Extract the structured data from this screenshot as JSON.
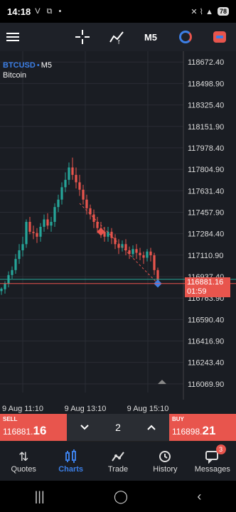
{
  "status": {
    "time": "14:18",
    "left_icons": "V ⧉ •",
    "right_icons": "✕ ⌇ ▲",
    "battery": "78"
  },
  "toolbar": {
    "menu_icon": "hamburger-icon",
    "crosshair_icon": "crosshair-icon",
    "indicator_icon": "indicator-icon",
    "timeframe": "M5",
    "objects_icon": "circle-icon",
    "trade_icon": "trade-icon"
  },
  "symbol": {
    "name": "BTCUSD",
    "timeframe": "M5",
    "description": "Bitcoin"
  },
  "price_tag": {
    "price": "116881.16",
    "countdown": "01:59"
  },
  "chart_data": {
    "type": "candlestick",
    "y_ticks": [
      "118672.40",
      "118498.90",
      "118325.40",
      "118151.90",
      "117978.40",
      "117804.90",
      "117631.40",
      "117457.90",
      "117284.40",
      "117110.90",
      "116937.40",
      "116763.90",
      "116590.40",
      "116416.90",
      "116243.40",
      "116069.90"
    ],
    "x_ticks": [
      "9 Aug 11:10",
      "9 Aug 13:10",
      "9 Aug 15:10"
    ],
    "ylim": [
      116000,
      118760
    ],
    "current_price": 116881.16,
    "ask_price": 116898.21,
    "colors": {
      "up": "#26a69a",
      "down": "#e8554d",
      "background": "#1a1d23",
      "grid": "#2a2d35"
    },
    "candles": [
      [
        116820,
        116840,
        116790,
        116850
      ],
      [
        116835,
        116880,
        116800,
        116900
      ],
      [
        116880,
        116950,
        116850,
        116980
      ],
      [
        116950,
        116990,
        116920,
        117020
      ],
      [
        116990,
        117080,
        116960,
        117120
      ],
      [
        117080,
        117150,
        117040,
        117200
      ],
      [
        117150,
        117200,
        117100,
        117260
      ],
      [
        117200,
        117380,
        117170,
        117400
      ],
      [
        117380,
        117300,
        117280,
        117420
      ],
      [
        117300,
        117290,
        117240,
        117350
      ],
      [
        117290,
        117260,
        117210,
        117330
      ],
      [
        117260,
        117340,
        117220,
        117370
      ],
      [
        117340,
        117400,
        117300,
        117440
      ],
      [
        117400,
        117350,
        117320,
        117450
      ],
      [
        117350,
        117380,
        117300,
        117420
      ],
      [
        117380,
        117500,
        117340,
        117530
      ],
      [
        117500,
        117560,
        117460,
        117600
      ],
      [
        117560,
        117660,
        117520,
        117700
      ],
      [
        117660,
        117720,
        117620,
        117780
      ],
      [
        117720,
        117820,
        117680,
        117860
      ],
      [
        117820,
        117760,
        117720,
        117900
      ],
      [
        117760,
        117700,
        117650,
        117820
      ],
      [
        117700,
        117640,
        117590,
        117760
      ],
      [
        117640,
        117560,
        117520,
        117680
      ],
      [
        117560,
        117490,
        117440,
        117600
      ],
      [
        117490,
        117440,
        117400,
        117520
      ],
      [
        117440,
        117380,
        117330,
        117480
      ],
      [
        117380,
        117330,
        117290,
        117420
      ],
      [
        117330,
        117300,
        117250,
        117380
      ],
      [
        117300,
        117260,
        117220,
        117340
      ],
      [
        117260,
        117300,
        117220,
        117340
      ],
      [
        117300,
        117250,
        117200,
        117330
      ],
      [
        117250,
        117200,
        117160,
        117280
      ],
      [
        117200,
        117170,
        117120,
        117240
      ],
      [
        117170,
        117200,
        117140,
        117230
      ],
      [
        117200,
        117150,
        117110,
        117240
      ],
      [
        117150,
        117120,
        117080,
        117180
      ],
      [
        117120,
        117160,
        117090,
        117190
      ],
      [
        117160,
        117130,
        117080,
        117200
      ],
      [
        117130,
        117110,
        117070,
        117170
      ],
      [
        117110,
        117090,
        117040,
        117140
      ],
      [
        117090,
        117140,
        117060,
        117160
      ],
      [
        117140,
        117110,
        117060,
        117170
      ],
      [
        117110,
        116990,
        116950,
        117130
      ],
      [
        116990,
        116900,
        116860,
        117010
      ]
    ]
  },
  "trade": {
    "sell_label": "SELL",
    "sell_price_small": "116881.",
    "sell_price_big": "16",
    "lot": "2",
    "buy_label": "BUY",
    "buy_price_small": "116898.",
    "buy_price_big": "21"
  },
  "nav": {
    "items": [
      {
        "label": "Quotes",
        "icon": "quotes-icon"
      },
      {
        "label": "Charts",
        "icon": "charts-icon"
      },
      {
        "label": "Trade",
        "icon": "trade-icon"
      },
      {
        "label": "History",
        "icon": "history-icon"
      },
      {
        "label": "Messages",
        "icon": "messages-icon"
      }
    ],
    "messages_badge": "3"
  }
}
